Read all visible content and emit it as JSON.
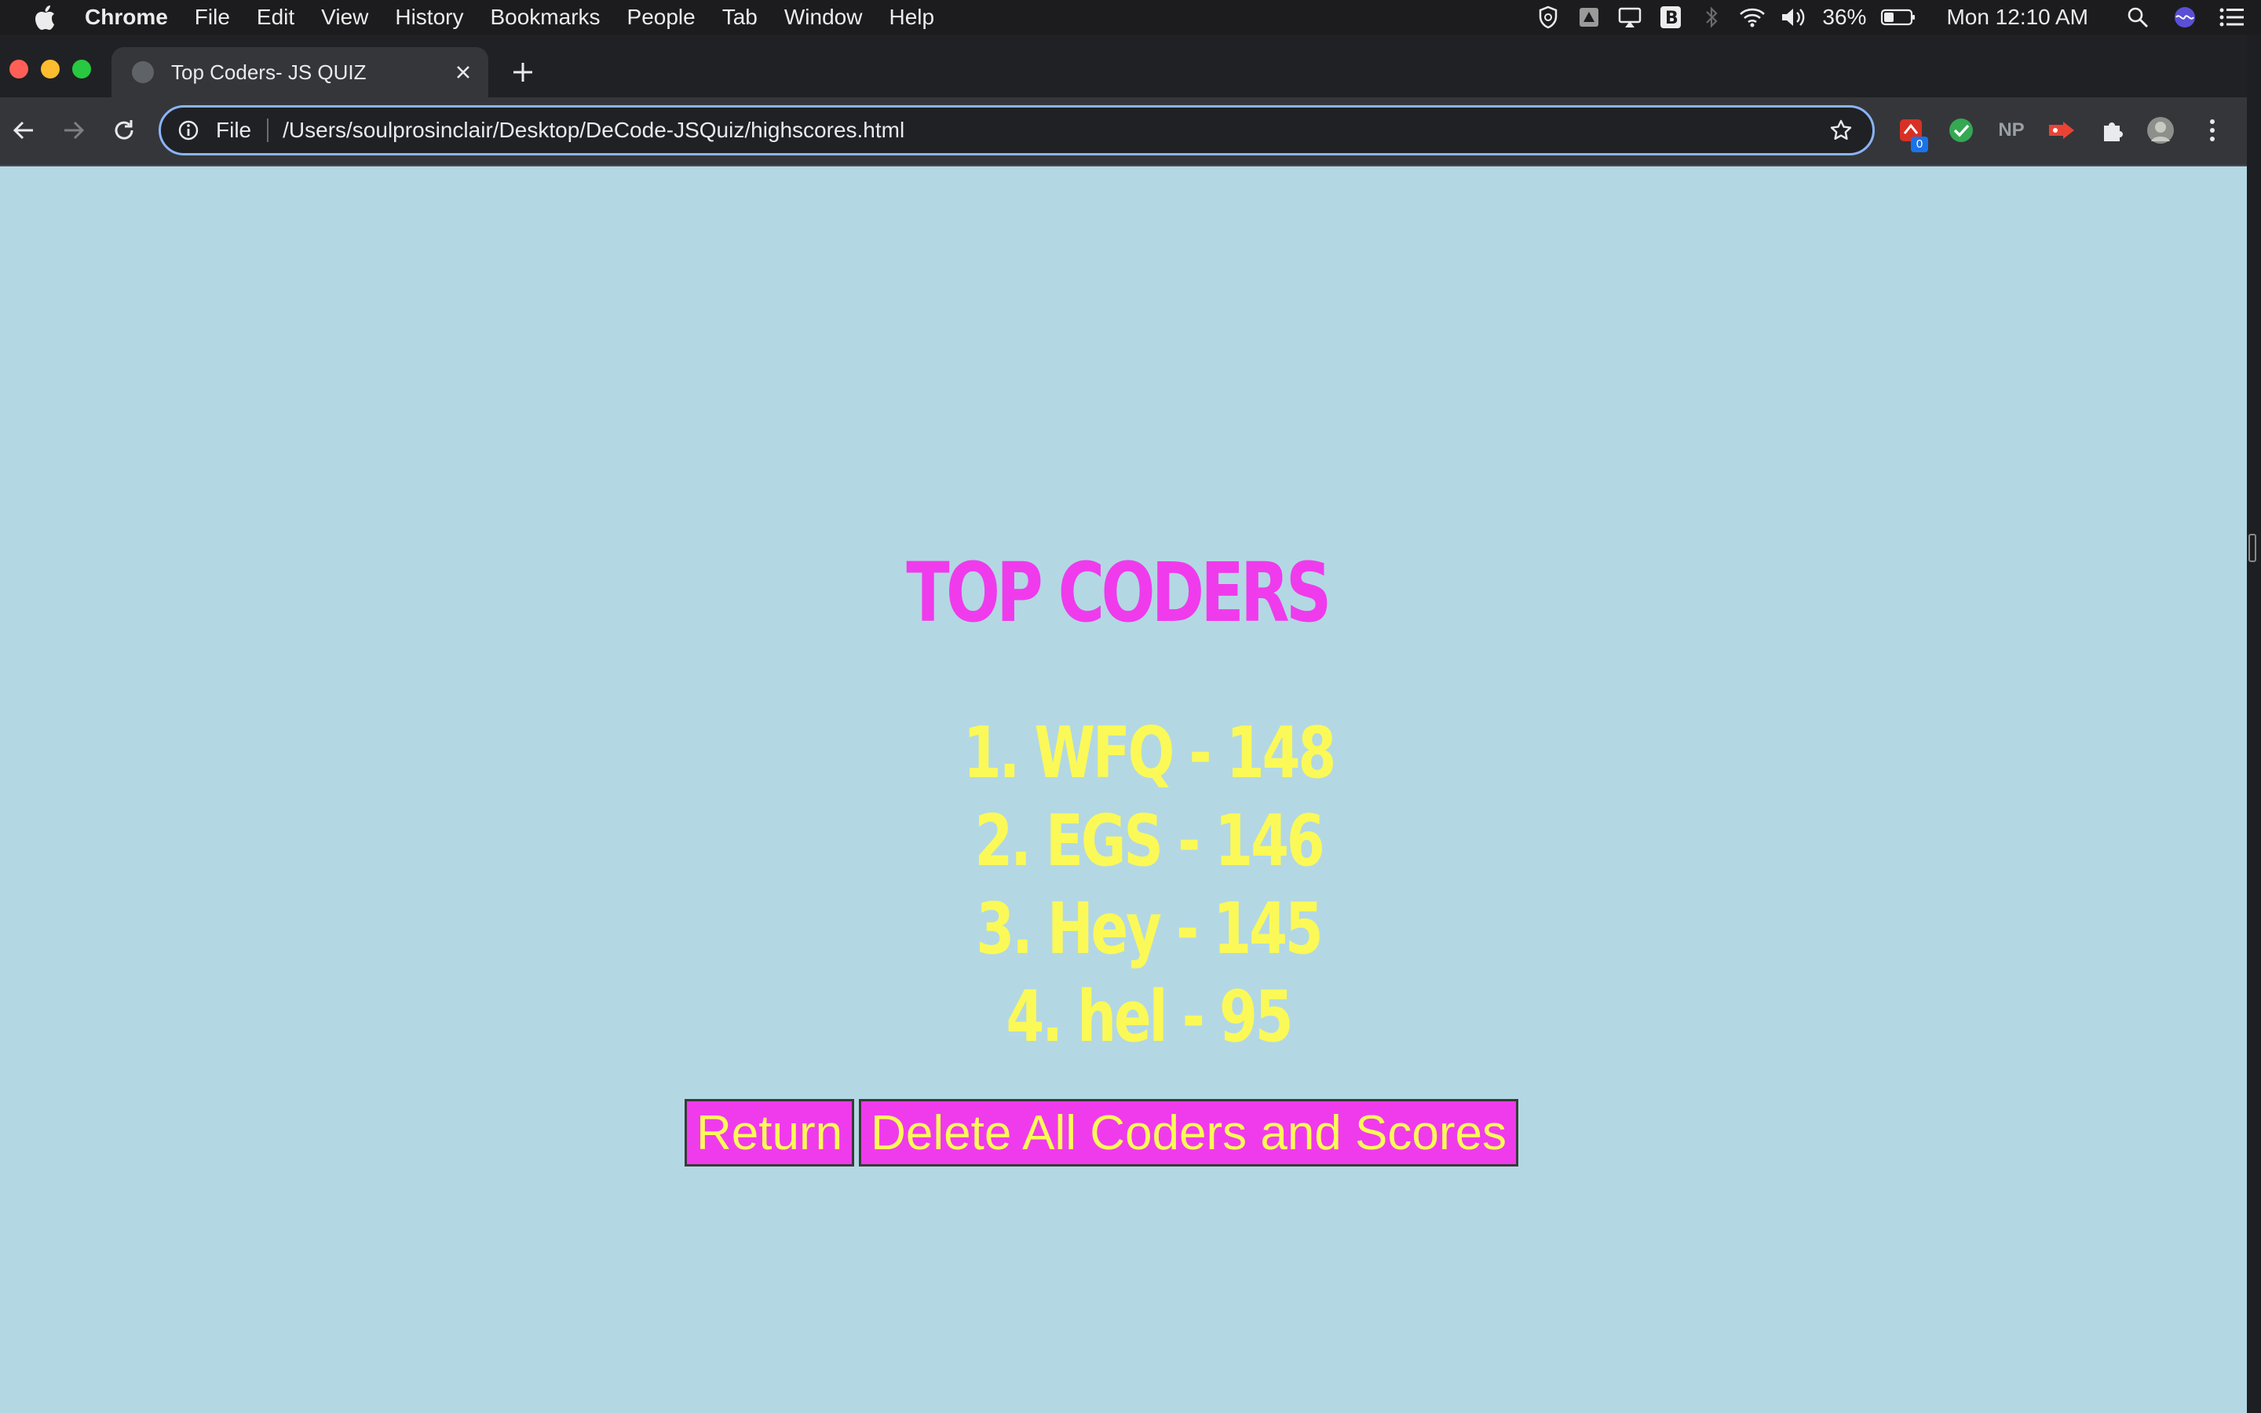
{
  "menubar": {
    "app_name": "Chrome",
    "menus": [
      "File",
      "Edit",
      "View",
      "History",
      "Bookmarks",
      "People",
      "Tab",
      "Window",
      "Help"
    ],
    "battery_percent": "36%",
    "clock": "Mon 12:10 AM",
    "status_icons": [
      "shield-icon",
      "drive-icon",
      "airplay-icon",
      "bold-b-icon",
      "bluetooth-icon",
      "wifi-icon",
      "volume-icon",
      "battery-icon",
      "spotlight-search-icon",
      "siri-icon",
      "control-center-icon"
    ]
  },
  "browser": {
    "tab_title": "Top Coders- JS QUIZ",
    "omnibox_scheme": "File",
    "omnibox_url": "/Users/soulprosinclair/Desktop/DeCode-JSQuiz/highscores.html",
    "extension_badge": "0",
    "np_extension_label": "NP",
    "accent_color": "#8ab4f8"
  },
  "page": {
    "title": "TOP CODERS",
    "scores": [
      "1. WFQ - 148",
      "2. EGS - 146",
      "3. Hey - 145",
      "4. hel - 95"
    ],
    "return_label": "Return",
    "delete_label": "Delete All Coders and Scores",
    "background_color": "#b3d8e3",
    "title_color": "#ef3bec",
    "score_color": "#fbf957"
  }
}
